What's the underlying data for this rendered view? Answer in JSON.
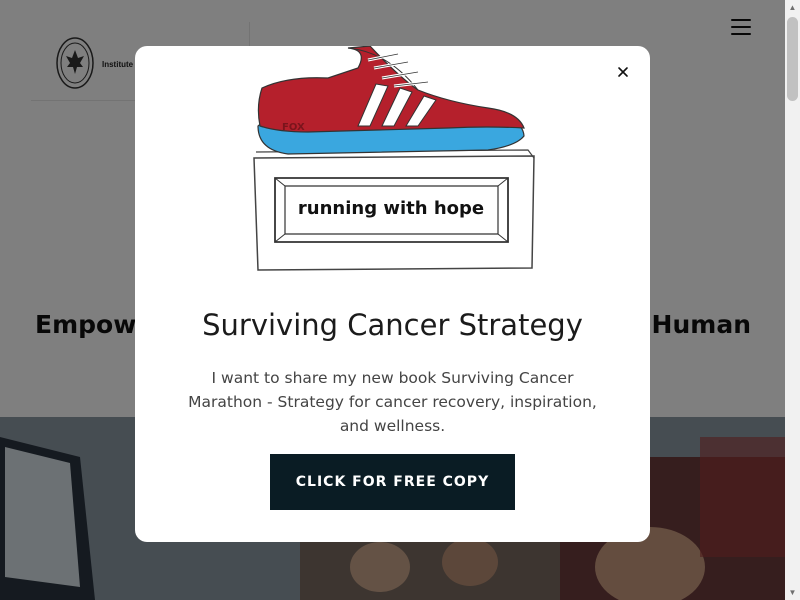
{
  "page": {
    "logo_text": "Institute",
    "hero_heading_left": "Empow",
    "hero_heading_right": "Human"
  },
  "modal": {
    "image_caption": "running with hope",
    "shoe_brand": "FOX",
    "title": "Surviving Cancer Strategy",
    "body": "I want to share my new book Surviving Cancer Marathon - Strategy for cancer recovery, inspiration, and wellness.",
    "cta_label": "CLICK FOR FREE COPY",
    "close_icon": "close-icon"
  },
  "colors": {
    "shoe_red": "#b5202c",
    "shoe_blue": "#3aa7df",
    "cta_bg": "#0a1c24",
    "overlay": "rgba(0,0,0,0.5)"
  }
}
